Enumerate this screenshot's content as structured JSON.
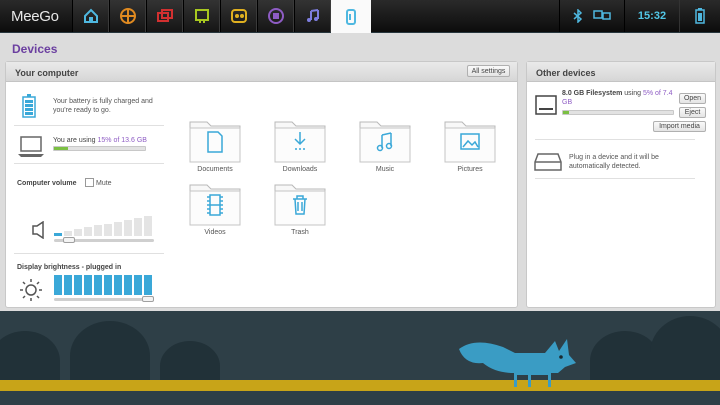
{
  "topbar": {
    "brand": "MeeGo",
    "zones": [
      {
        "icon": "myzone-home-icon",
        "color": "#4fb8e0"
      },
      {
        "icon": "status-icon",
        "color": "#e08a20"
      },
      {
        "icon": "people-icon",
        "color": "#d23030"
      },
      {
        "icon": "internet-icon",
        "color": "#a8c820"
      },
      {
        "icon": "media-icon",
        "color": "#e0b020"
      },
      {
        "icon": "pasteboard-icon",
        "color": "#8e5cc4"
      },
      {
        "icon": "music-icon",
        "color": "#7e7ee0"
      },
      {
        "icon": "devices-icon",
        "color": "#4fb8e0",
        "active": true
      }
    ],
    "clock": "15:32",
    "status_icons": [
      "bluetooth-icon",
      "display-icon"
    ]
  },
  "page": {
    "title": "Devices"
  },
  "your_computer": {
    "header": "Your computer",
    "all_settings": "All settings",
    "battery_text": "Your battery is fully charged and you're ready to go.",
    "storage_prefix": "You are using",
    "storage_value": "15% of 13.6 GB",
    "storage_fraction": 0.15,
    "volume_label": "Computer volume",
    "mute_label": "Mute",
    "volume_fraction": 0.1,
    "brightness_label": "Display brightness - plugged in",
    "brightness_fraction": 1.0
  },
  "folders": [
    {
      "label": "Documents",
      "icon": "document-icon"
    },
    {
      "label": "Downloads",
      "icon": "download-icon"
    },
    {
      "label": "Music",
      "icon": "music-note-icon"
    },
    {
      "label": "Pictures",
      "icon": "picture-icon"
    },
    {
      "label": "Videos",
      "icon": "film-icon"
    },
    {
      "label": "Trash",
      "icon": "trash-icon"
    }
  ],
  "other_devices": {
    "header": "Other devices",
    "fs_name": "8.0 GB Filesystem",
    "fs_using": "using",
    "fs_usage": "5% of 7.4 GB",
    "fs_fraction": 0.05,
    "open": "Open",
    "eject": "Eject",
    "import": "Import media",
    "hint": "Plug in a device and it will be automatically detected."
  }
}
